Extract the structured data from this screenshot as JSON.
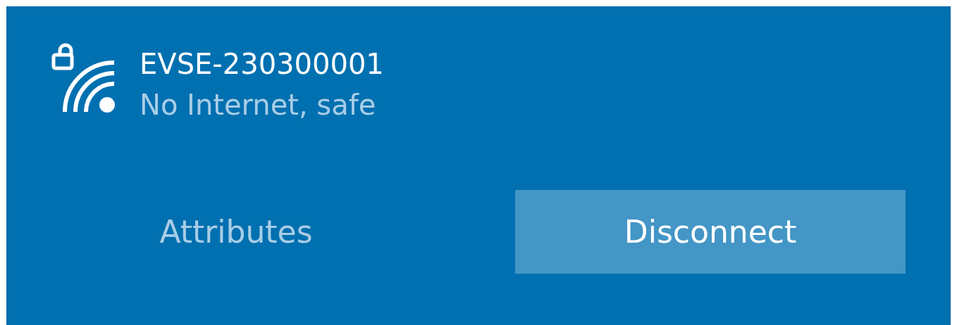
{
  "network": {
    "name": "EVSE-230300001",
    "status": "No Internet, safe",
    "secured": true
  },
  "buttons": [
    {
      "label": "Attributes",
      "kind": "text"
    },
    {
      "label": "Disconnect",
      "kind": "filled"
    }
  ]
}
